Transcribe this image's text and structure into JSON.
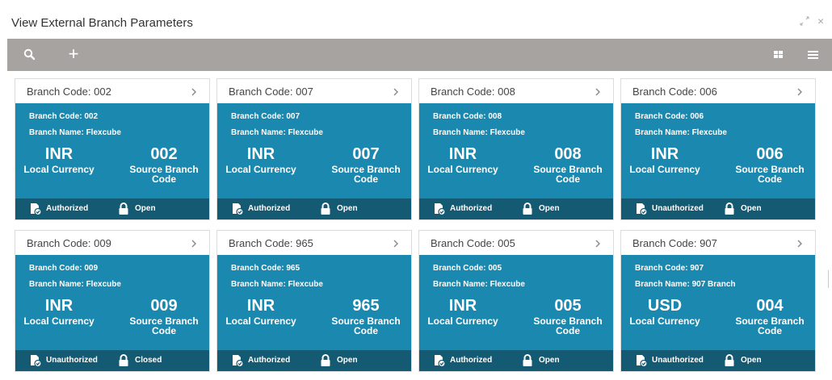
{
  "window": {
    "title": "View External Branch Parameters",
    "expand_icon": "expand-icon",
    "close_icon": "close-icon",
    "close_glyph": "×"
  },
  "toolbar": {
    "search_icon": "search-icon",
    "add_icon": "plus-icon",
    "add_glyph": "+",
    "grid_view_icon": "grid-view-icon",
    "list_view_icon": "list-view-icon",
    "background": "#a6a3a0"
  },
  "colors": {
    "card_body": "#1b88b0",
    "card_footer": "#155a73"
  },
  "cards": [
    {
      "header": "Branch Code:  002",
      "meta_code": "Branch Code:  002",
      "meta_name": "Branch Name:  Flexcube",
      "currency": "INR",
      "currency_label": "Local Currency",
      "source_code": "002",
      "source_label_1": "Source Branch",
      "source_label_2": "Code",
      "auth_status": "Authorized",
      "record_status": "Open"
    },
    {
      "header": "Branch Code:  007",
      "meta_code": "Branch Code:  007",
      "meta_name": "Branch Name:  Flexcube",
      "currency": "INR",
      "currency_label": "Local Currency",
      "source_code": "007",
      "source_label_1": "Source Branch",
      "source_label_2": "Code",
      "auth_status": "Authorized",
      "record_status": "Open"
    },
    {
      "header": "Branch Code:  008",
      "meta_code": "Branch Code:  008",
      "meta_name": "Branch Name:  Flexcube",
      "currency": "INR",
      "currency_label": "Local Currency",
      "source_code": "008",
      "source_label_1": "Source Branch",
      "source_label_2": "Code",
      "auth_status": "Authorized",
      "record_status": "Open"
    },
    {
      "header": "Branch Code:  006",
      "meta_code": "Branch Code:  006",
      "meta_name": "Branch Name:  Flexcube",
      "currency": "INR",
      "currency_label": "Local Currency",
      "source_code": "006",
      "source_label_1": "Source Branch",
      "source_label_2": "Code",
      "auth_status": "Unauthorized",
      "record_status": "Open"
    },
    {
      "header": "Branch Code:  009",
      "meta_code": "Branch Code:  009",
      "meta_name": "Branch Name:  Flexcube",
      "currency": "INR",
      "currency_label": "Local Currency",
      "source_code": "009",
      "source_label_1": "Source Branch",
      "source_label_2": "Code",
      "auth_status": "Unauthorized",
      "record_status": "Closed"
    },
    {
      "header": "Branch Code:  965",
      "meta_code": "Branch Code:  965",
      "meta_name": "Branch Name:  Flexcube",
      "currency": "INR",
      "currency_label": "Local Currency",
      "source_code": "965",
      "source_label_1": "Source Branch",
      "source_label_2": "Code",
      "auth_status": "Authorized",
      "record_status": "Open"
    },
    {
      "header": "Branch Code:  005",
      "meta_code": "Branch Code:  005",
      "meta_name": "Branch Name:  Flexcube",
      "currency": "INR",
      "currency_label": "Local Currency",
      "source_code": "005",
      "source_label_1": "Source Branch",
      "source_label_2": "Code",
      "auth_status": "Authorized",
      "record_status": "Open"
    },
    {
      "header": "Branch Code:  907",
      "meta_code": "Branch Code:  907",
      "meta_name": "Branch Name:  907 Branch",
      "currency": "USD",
      "currency_label": "Local Currency",
      "source_code": "004",
      "source_label_1": "Source Branch",
      "source_label_2": "Code",
      "auth_status": "Unauthorized",
      "record_status": "Open"
    }
  ]
}
